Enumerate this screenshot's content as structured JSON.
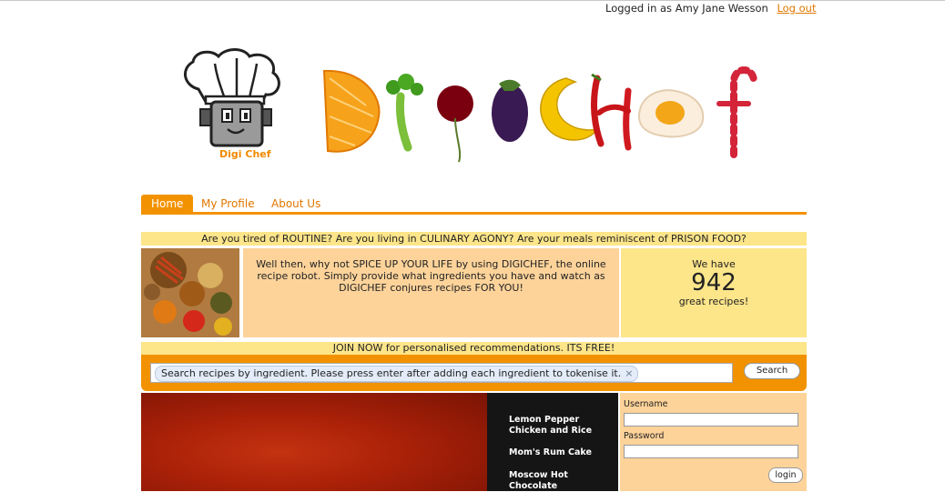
{
  "header": {
    "logged_in_text": "Logged in as Amy Jane Wesson",
    "logout_label": "Log out"
  },
  "brand": {
    "mascot_label": "Digi Chef",
    "logo_word": "DigiChef",
    "accent_color": "#f39200"
  },
  "nav": {
    "tabs": [
      {
        "label": "Home",
        "active": true
      },
      {
        "label": "My Profile",
        "active": false
      },
      {
        "label": "About Us",
        "active": false
      }
    ]
  },
  "tagline": "Are you tired of ROUTINE? Are you living in CULINARY AGONY? Are your meals reminiscent of PRISON FOOD?",
  "promo": {
    "text": "Well then, why not SPICE UP YOUR LIFE by using DIGICHEF, the online recipe robot. Simply provide what ingredients you have and watch as DIGICHEF conjures recipes FOR YOU!",
    "stats_prefix": "We have",
    "recipe_count": "942",
    "stats_suffix": "great recipes!"
  },
  "join_text": "JOIN NOW for personalised recommendations. ITS FREE!",
  "search": {
    "token_text": "Search recipes by ingredient. Please press enter after adding each ingredient to tokenise it.",
    "token_remove": "×",
    "button_label": "Search"
  },
  "featured_recipes": [
    "Lemon Pepper Chicken and Rice",
    "Mom's Rum Cake",
    "Moscow Hot Chocolate"
  ],
  "login": {
    "username_label": "Username",
    "password_label": "Password",
    "button_label": "login"
  }
}
